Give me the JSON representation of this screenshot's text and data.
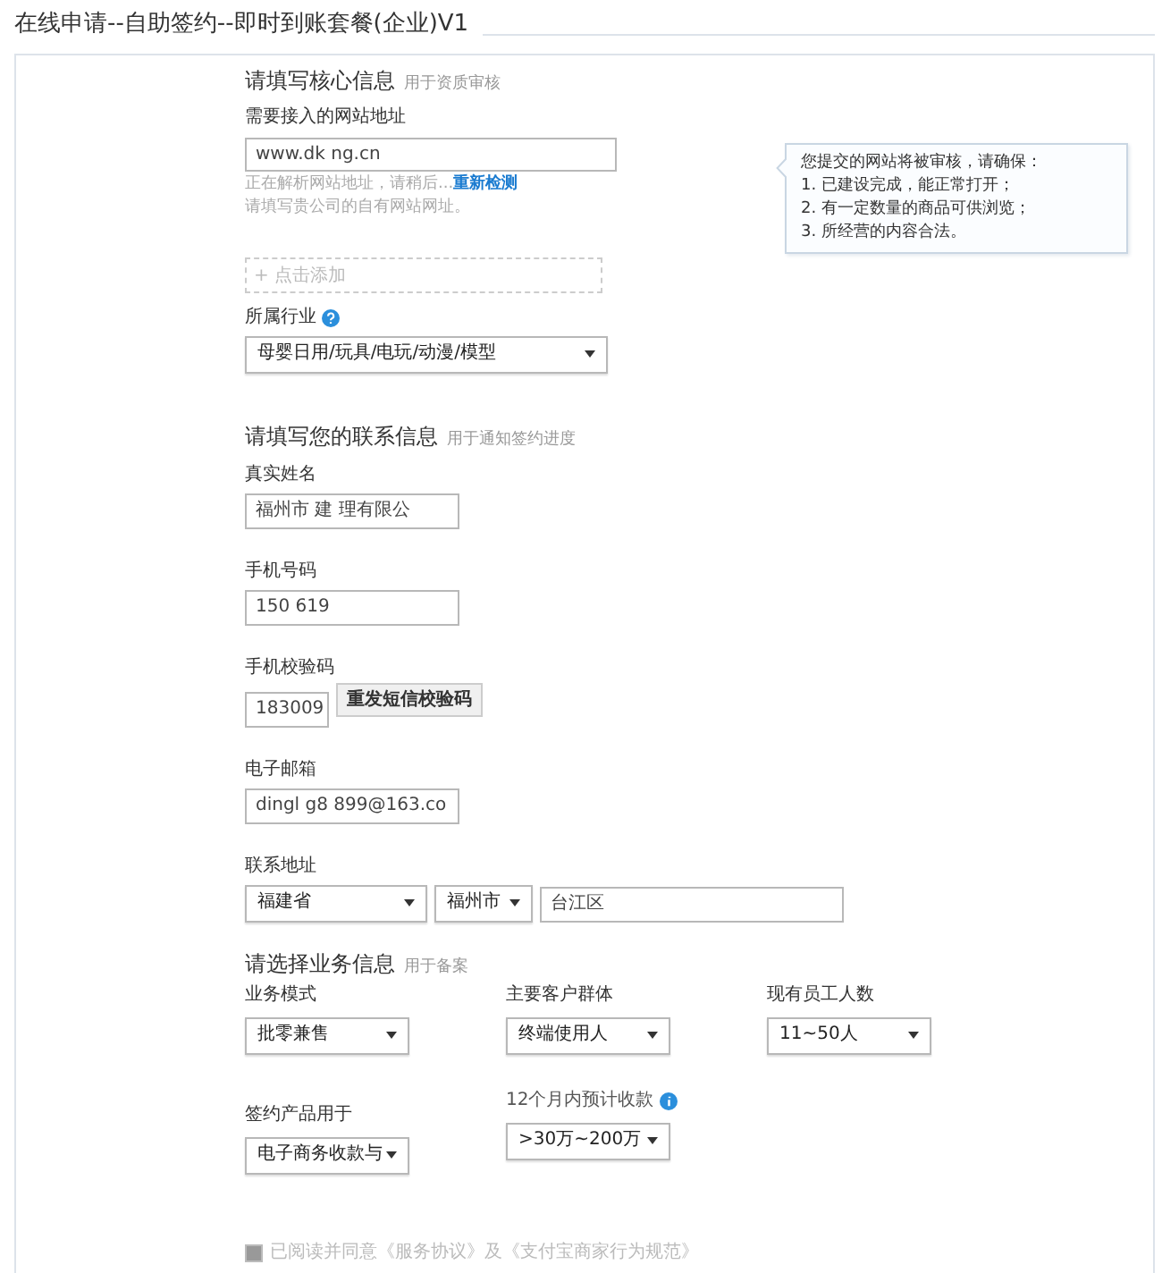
{
  "page_title": "在线申请--自助签约--即时到账套餐(企业)V1",
  "core": {
    "title": "请填写核心信息",
    "subtitle": "用于资质审核",
    "url_field": {
      "label": "需要接入的网站地址",
      "value": "www.dk  ng.cn",
      "status": "正在解析网站地址，请稍后...",
      "link": "重新检测",
      "hint": "请填写贵公司的自有网站网址。"
    },
    "tooltip": {
      "lines": [
        "您提交的网站将被审核，请确保：",
        "1. 已建设完成，能正常打开；",
        "2. 有一定数量的商品可供浏览；",
        "3. 所经营的内容合法。"
      ]
    },
    "add_button": "+ 点击添加",
    "industry": {
      "label": "所属行业",
      "help_icon": {
        "kind": "question"
      },
      "value": "母婴日用/玩具/电玩/动漫/模型"
    }
  },
  "contact": {
    "title": "请填写您的联系信息",
    "subtitle": "用于通知签约进度",
    "fields": [
      {
        "kind": "text",
        "label": "真实姓名",
        "value": "福州市  建  理有限公"
      },
      {
        "kind": "text",
        "label": "手机号码",
        "value": "150  619"
      },
      {
        "kind": "code",
        "label": "手机校验码",
        "value": "183009",
        "button": "重发短信校验码"
      },
      {
        "kind": "text",
        "label": "电子邮箱",
        "value": "dingl g8  899@163.co"
      },
      {
        "kind": "address",
        "label": "联系地址",
        "province": "福建省",
        "city": "福州市",
        "value": "台江区"
      }
    ]
  },
  "business": {
    "title": "请选择业务信息",
    "subtitle": "用于备案",
    "rows": [
      [
        {
          "label": "业务模式",
          "value": "批零兼售"
        },
        {
          "label": "主要客户群体",
          "value": "终端使用人"
        },
        {
          "label": "现有员工人数",
          "value": "11~50人"
        }
      ],
      [
        {
          "label": "签约产品用于",
          "value": "电子商务收款与"
        },
        {
          "label": "12个月内预计收款",
          "help_icon": {
            "kind": "info"
          },
          "value": ">30万~200万"
        }
      ]
    ]
  },
  "agreement": {
    "checked": true,
    "text": "已阅读并同意《服务协议》及《支付宝商家行为规范》"
  }
}
